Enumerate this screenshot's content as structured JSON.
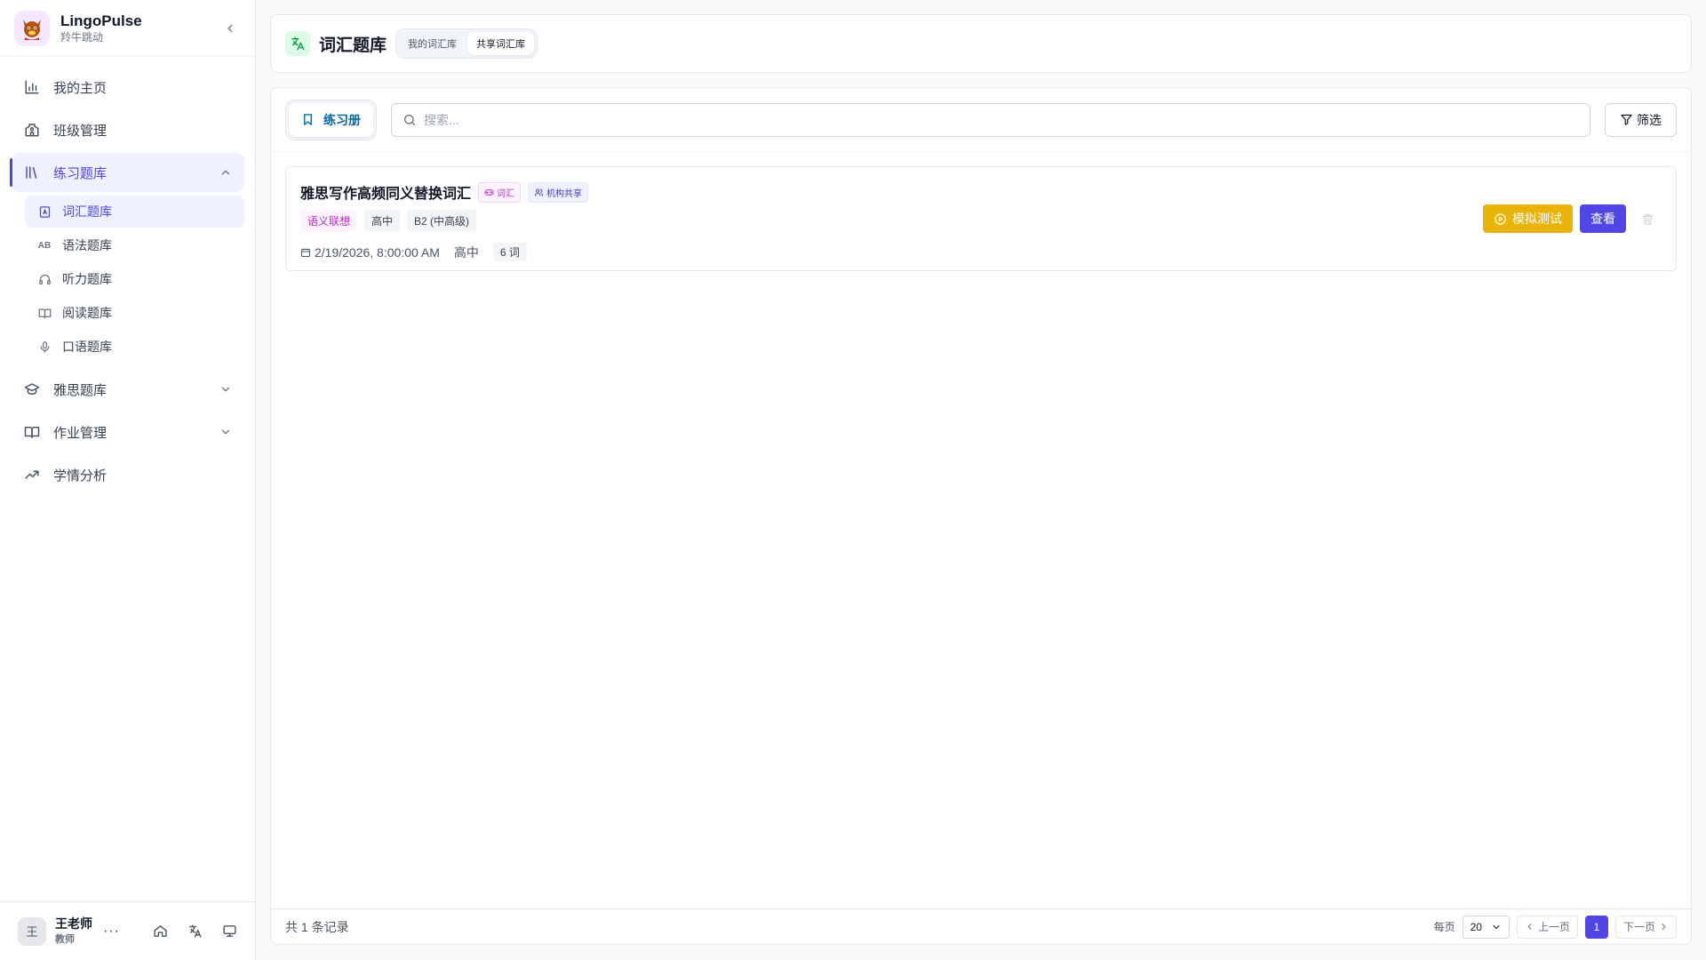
{
  "app": {
    "name": "LingoPulse",
    "subtitle": "羚牛跳动"
  },
  "sidebar": {
    "items": [
      {
        "label": "我的主页"
      },
      {
        "label": "班级管理"
      },
      {
        "label": "练习题库"
      },
      {
        "label": "雅思题库"
      },
      {
        "label": "作业管理"
      },
      {
        "label": "学情分析"
      }
    ],
    "sub_items": [
      {
        "label": "词汇题库",
        "icon_text": ""
      },
      {
        "label": "语法题库",
        "icon_text": "AB"
      },
      {
        "label": "听力题库",
        "icon_text": ""
      },
      {
        "label": "阅读题库",
        "icon_text": ""
      },
      {
        "label": "口语题库",
        "icon_text": ""
      }
    ]
  },
  "user": {
    "initial": "王",
    "name": "王老师",
    "role": "教师",
    "more": "···"
  },
  "header": {
    "title": "词汇题库",
    "tabs": [
      {
        "label": "我的词汇库"
      },
      {
        "label": "共享词汇库"
      }
    ]
  },
  "toolbar": {
    "tab_label": "练习册",
    "search_placeholder": "搜索...",
    "filter_label": "筛选"
  },
  "items": [
    {
      "title": "雅思写作高频同义替换词汇",
      "badge_type": "词汇",
      "badge_share": "机构共享",
      "tags": [
        "语义联想",
        "高中",
        "B2 (中高级)"
      ],
      "date": "2/19/2026, 8:00:00 AM",
      "level": "高中",
      "count": "6 词",
      "test_label": "模拟测试",
      "view_label": "查看"
    }
  ],
  "footer": {
    "total": "共 1 条记录",
    "per_page_label": "每页",
    "page_size": "20",
    "prev": "上一页",
    "current_page": "1",
    "next": "下一页"
  },
  "colors": {
    "accent": "#4f46e5",
    "warning": "#eab308",
    "success": "#16a34a",
    "info": "#0369a1"
  }
}
